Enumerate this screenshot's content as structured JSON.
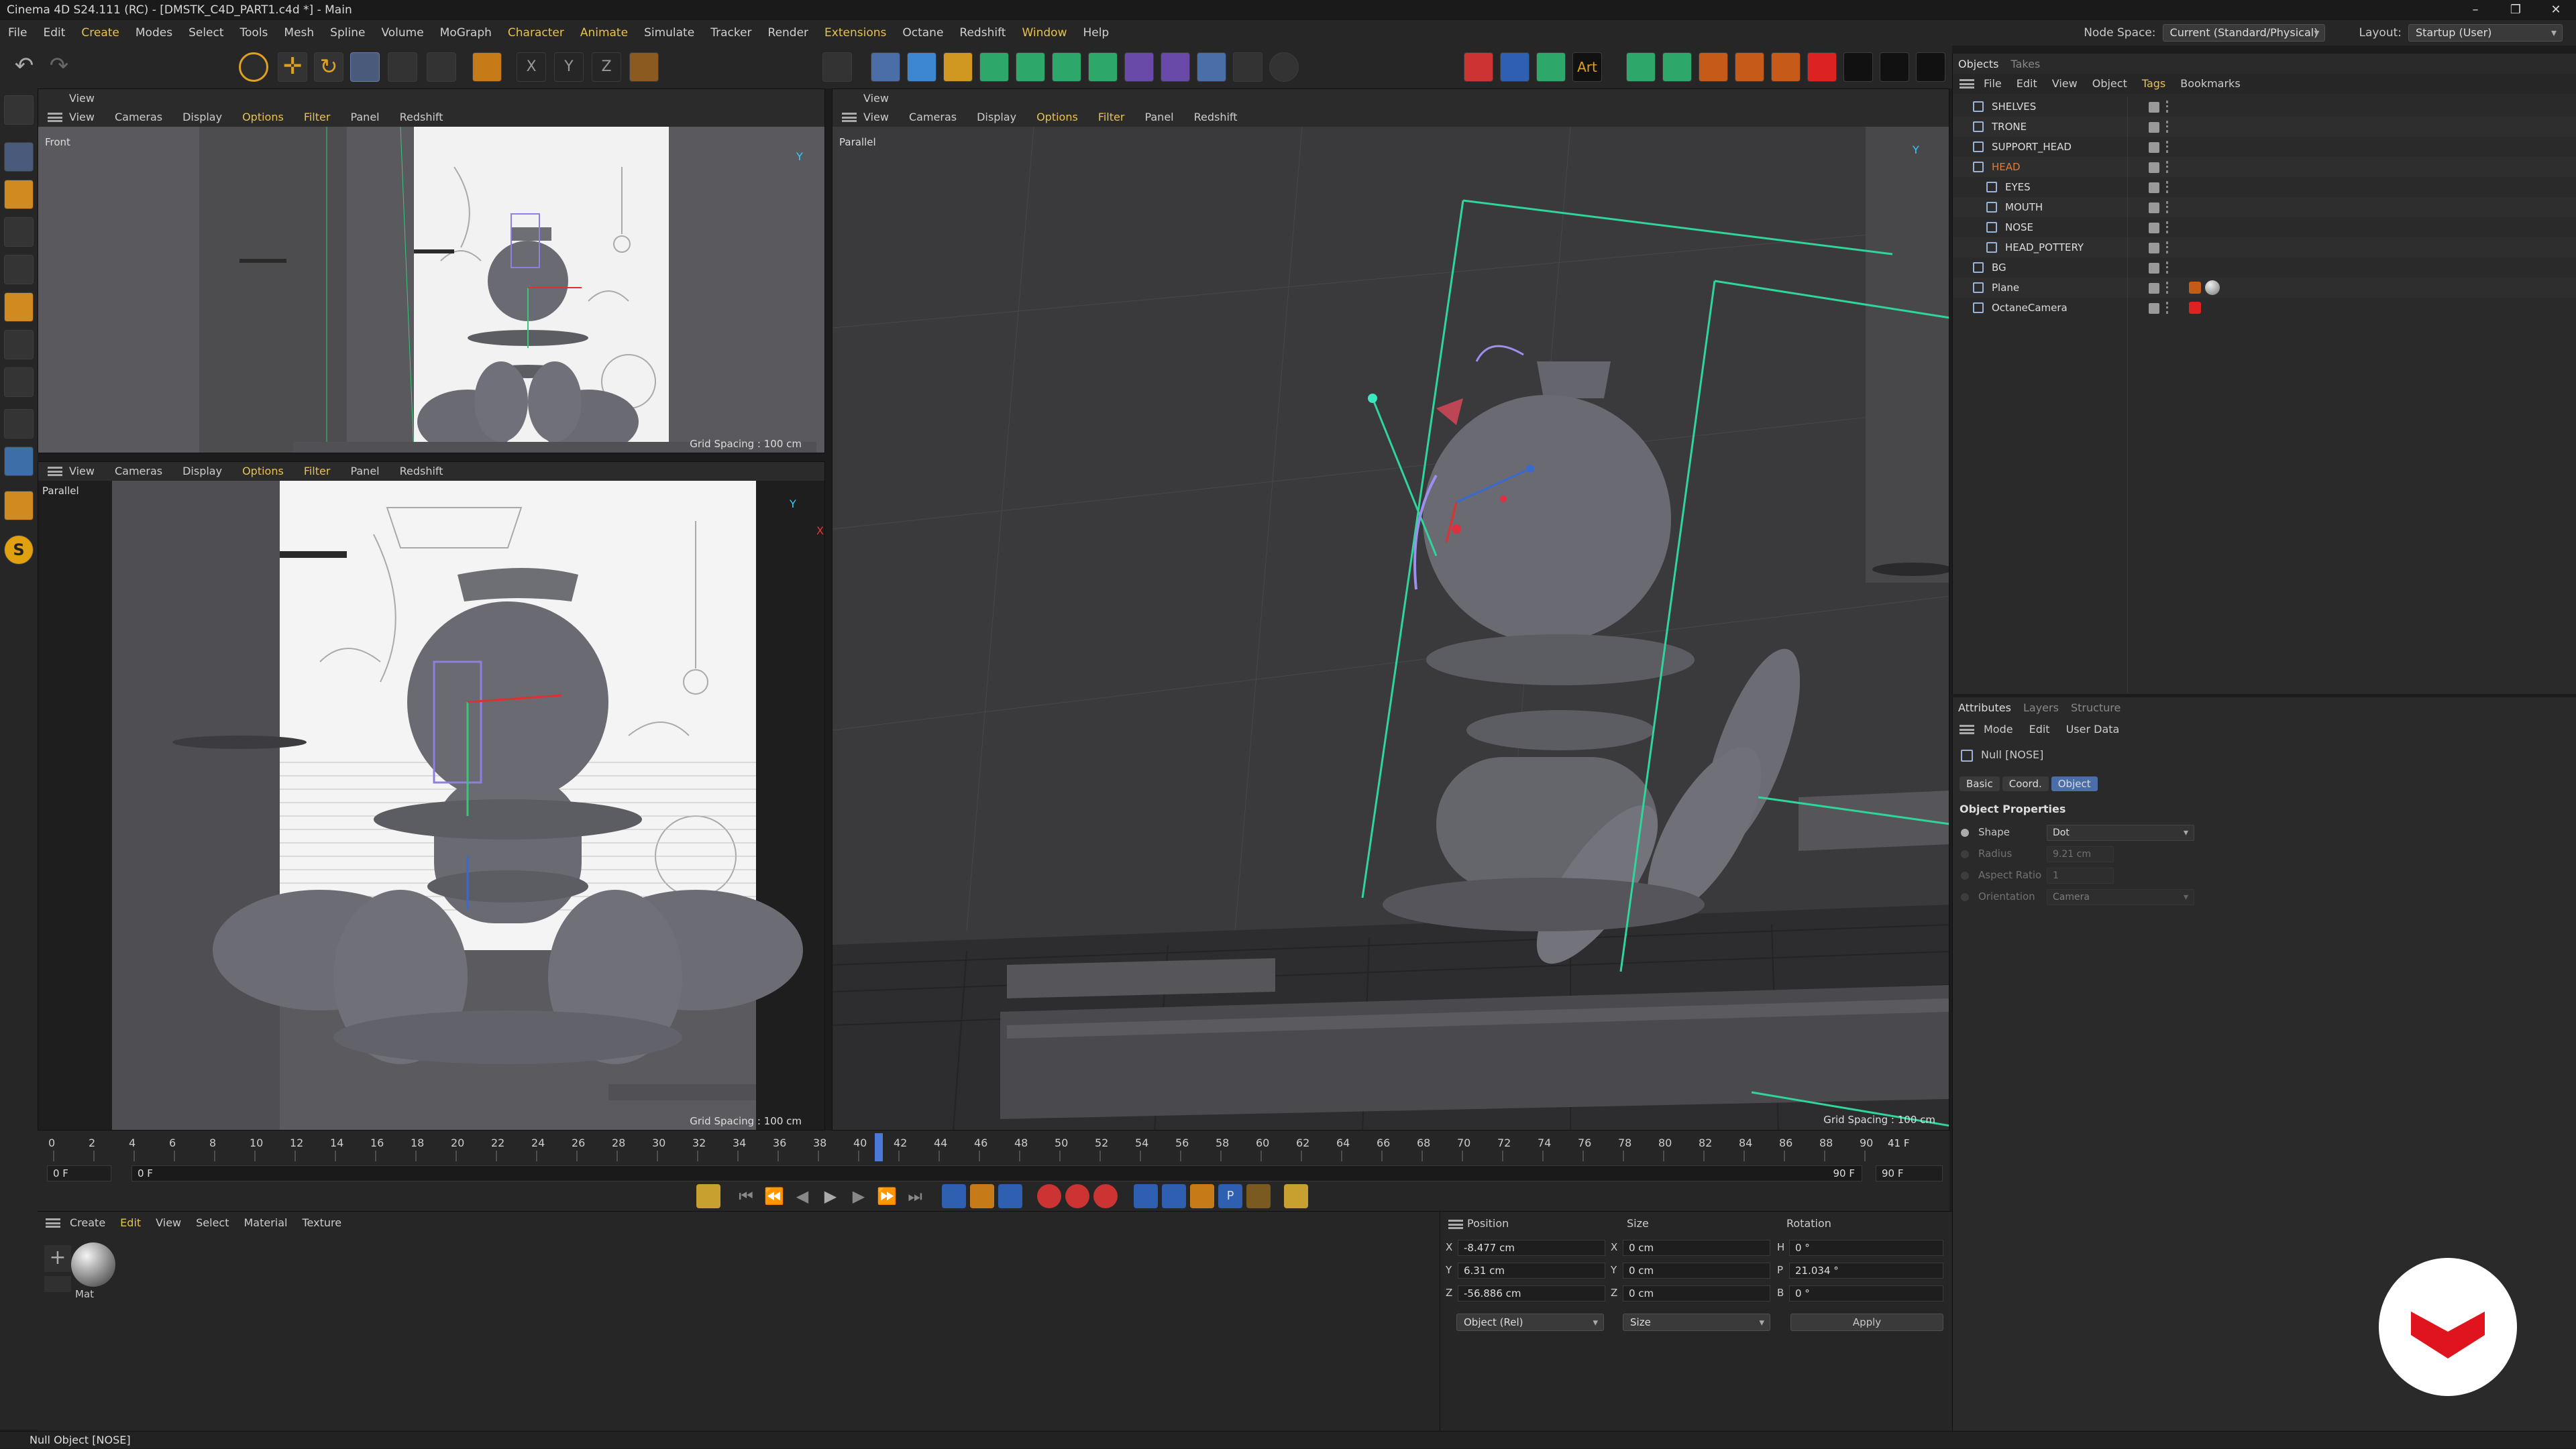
{
  "window": {
    "title": "Cinema 4D S24.111 (RC) - [DMSTK_C4D_PART1.c4d *] - Main"
  },
  "menubar": {
    "items": [
      "File",
      "Edit",
      "Create",
      "Modes",
      "Select",
      "Tools",
      "Mesh",
      "Spline",
      "Volume",
      "MoGraph",
      "Character",
      "Animate",
      "Simulate",
      "Tracker",
      "Render",
      "Extensions",
      "Octane",
      "Redshift",
      "Window",
      "Help"
    ],
    "node_space_label": "Node Space:",
    "node_space_value": "Current (Standard/Physical)",
    "layout_label": "Layout:",
    "layout_value": "Startup (User)"
  },
  "viewport_menu": {
    "items": [
      "View",
      "Cameras",
      "Display",
      "Options",
      "Filter",
      "Panel",
      "Redshift"
    ]
  },
  "viewports": {
    "top_left": {
      "header": "View",
      "label": "Front",
      "grid": "Grid Spacing : 100 cm"
    },
    "bottom_left": {
      "label": "Parallel",
      "grid": "Grid Spacing : 100 cm"
    },
    "right": {
      "header": "View",
      "label": "Parallel",
      "grid": "Grid Spacing : 100 cm"
    }
  },
  "objects": {
    "tabs": [
      "Objects",
      "Takes"
    ],
    "menu": [
      "File",
      "Edit",
      "View",
      "Object",
      "Tags",
      "Bookmarks"
    ],
    "rows": [
      {
        "name": "SHELVES",
        "indent": 0,
        "color": "#ddd"
      },
      {
        "name": "TRONE",
        "indent": 0,
        "color": "#ddd"
      },
      {
        "name": "SUPPORT_HEAD",
        "indent": 0,
        "color": "#ddd"
      },
      {
        "name": "HEAD",
        "indent": 0,
        "color": "#e07c3a"
      },
      {
        "name": "EYES",
        "indent": 1,
        "color": "#ddd"
      },
      {
        "name": "MOUTH",
        "indent": 1,
        "color": "#ddd"
      },
      {
        "name": "NOSE",
        "indent": 1,
        "color": "#ddd"
      },
      {
        "name": "HEAD_POTTERY",
        "indent": 1,
        "color": "#ddd"
      },
      {
        "name": "BG",
        "indent": 0,
        "color": "#ddd"
      },
      {
        "name": "Plane",
        "indent": 0,
        "color": "#ddd"
      },
      {
        "name": "OctaneCamera",
        "indent": 0,
        "color": "#ddd"
      }
    ]
  },
  "attributes": {
    "tabs": [
      "Attributes",
      "Layers",
      "Structure"
    ],
    "menu": [
      "Mode",
      "Edit",
      "User Data"
    ],
    "object_title": "Null [NOSE]",
    "subtabs": [
      "Basic",
      "Coord.",
      "Object"
    ],
    "section": "Object Properties",
    "props": [
      {
        "label": "Shape",
        "value": "Dot",
        "enabled": true
      },
      {
        "label": "Radius",
        "value": "9.21 cm",
        "enabled": false
      },
      {
        "label": "Aspect Ratio",
        "value": "1",
        "enabled": false
      },
      {
        "label": "Orientation",
        "value": "Camera",
        "enabled": false
      }
    ]
  },
  "timeline": {
    "ticks": [
      "0",
      "2",
      "4",
      "6",
      "8",
      "10",
      "12",
      "14",
      "16",
      "18",
      "20",
      "22",
      "24",
      "26",
      "28",
      "30",
      "32",
      "34",
      "36",
      "38",
      "40",
      "42",
      "44",
      "46",
      "48",
      "50",
      "52",
      "54",
      "56",
      "58",
      "60",
      "62",
      "64",
      "66",
      "68",
      "70",
      "72",
      "74",
      "76",
      "78",
      "80",
      "82",
      "84",
      "86",
      "88",
      "90"
    ],
    "current_frame": "41 F",
    "start": "0 F",
    "start2": "0 F",
    "end": "90 F",
    "end2": "90 F",
    "playhead": 41
  },
  "material": {
    "menu": [
      "Create",
      "Edit",
      "View",
      "Select",
      "Material",
      "Texture"
    ],
    "mat_name": "Mat"
  },
  "coords": {
    "headers": [
      "Position",
      "Size",
      "Rotation"
    ],
    "rows": [
      {
        "axis": "X",
        "pos": "-8.477 cm",
        "saxis": "X",
        "size": "0 cm",
        "raxis": "H",
        "rot": "0 °"
      },
      {
        "axis": "Y",
        "pos": "6.31 cm",
        "saxis": "Y",
        "size": "0 cm",
        "raxis": "P",
        "rot": "21.034 °"
      },
      {
        "axis": "Z",
        "pos": "-56.886 cm",
        "saxis": "Z",
        "size": "0 cm",
        "raxis": "B",
        "rot": "0 °"
      }
    ],
    "mode": "Object (Rel)",
    "size_mode": "Size",
    "apply": "Apply"
  },
  "status": {
    "text": "Null Object [NOSE]"
  },
  "colors": {
    "accent": "#e8c24c",
    "selected": "#e07c3a",
    "logo": "#e0141e"
  }
}
